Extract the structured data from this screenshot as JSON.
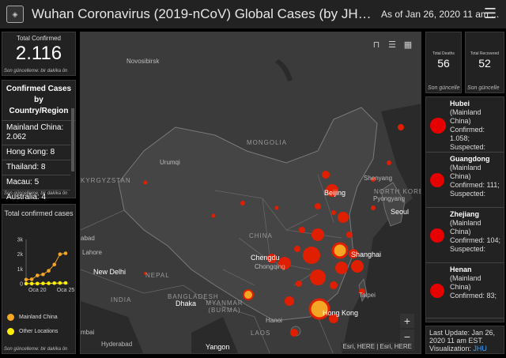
{
  "header": {
    "title": "Wuhan Coronavirus (2019-nCoV) Global Cases (by JHU ...",
    "as_of": "As of Jan 26, 2020 11 am ...",
    "menu_icon": "hamburger-menu-icon"
  },
  "total_confirmed": {
    "label": "Total Confirmed",
    "value": "2.116",
    "update_note": "Son güncelleme: bir dakika ön"
  },
  "country_list": {
    "heading": "Confirmed Cases by Country/Region",
    "rows": [
      "Mainland China: 2.062",
      "Hong Kong: 8",
      "Thailand: 8",
      "Macau: 5",
      "Australia: 4"
    ],
    "update_note": "Son güncelleme: bir dakika ön"
  },
  "chart_panel": {
    "heading": "Total confirmed cases",
    "legend": [
      "Mainland China",
      "Other Locations"
    ],
    "update_note": "Son güncelleme: bir dakika ön"
  },
  "chart_data": {
    "type": "line",
    "ylabel_ticks": [
      "0",
      "1k",
      "2k",
      "3k"
    ],
    "xlabel_ticks": [
      "Oca 20",
      "Oca 25"
    ],
    "ylim": [
      0,
      3000
    ],
    "x": [
      0,
      1,
      2,
      3,
      4,
      5,
      6,
      7
    ],
    "series": [
      {
        "name": "Mainland China",
        "values": [
          280,
          300,
          560,
          630,
          880,
          1300,
          2000,
          2062
        ],
        "color": "#f5a623"
      },
      {
        "name": "Other Locations",
        "values": [
          4,
          6,
          10,
          20,
          30,
          40,
          48,
          54
        ],
        "color": "#ffee00"
      }
    ]
  },
  "map": {
    "labels": {
      "novosibirsk": "Novosibirsk",
      "mongolia": "MONGOLIA",
      "urumqi": "Urumqi",
      "kyrgyzstan": "KYRGYZSTAN",
      "shenyang": "Shenyang",
      "beijing": "Beijing",
      "north_korea": "NORTH KOREA",
      "pyongyang": "Pyongyang",
      "seoul": "Seoul",
      "abad": "abad",
      "lahore": "Lahore",
      "china": "CHINA",
      "chengdu": "Chengdu",
      "chongqing": "Chongqing",
      "shanghai": "Shanghai",
      "new_delhi": "New Delhi",
      "nepal": "NEPAL",
      "india": "INDIA",
      "bangladesh": "BANGLADESH",
      "dhaka": "Dhaka",
      "myanmar": "MYANMAR (BURMA)",
      "taipei": "Taipei",
      "hong_kong": "Hong Kong",
      "hanoi": "Hanoi",
      "mbai": "mbai",
      "hyderabad": "Hyderabad",
      "yangon": "Yangon",
      "laos": "LAOS"
    },
    "attribution": "Esri, HERE | Esri, HERE",
    "zoom_in": "+",
    "zoom_out": "−"
  },
  "deaths": {
    "label": "Total Deaths",
    "value": "56",
    "update_note": "Son güncelle"
  },
  "recovered": {
    "label": "Total Recovered",
    "value": "52",
    "update_note": "Son güncelle"
  },
  "region_list": [
    {
      "name": "Hubei",
      "detail": "(Mainland China)",
      "confirmed": "Confirmed: 1.058;",
      "suspected": "Suspected:"
    },
    {
      "name": "Guangdong",
      "detail": "(Mainland China)",
      "confirmed": "Confirmed: 111;",
      "suspected": "Suspected:"
    },
    {
      "name": "Zhejiang",
      "detail": "(Mainland China)",
      "confirmed": "Confirmed: 104;",
      "suspected": "Suspected:"
    },
    {
      "name": "Henan",
      "detail": "(Mainland China)",
      "confirmed": "Confirmed: 83;",
      "suspected": ""
    }
  ],
  "last_update": {
    "line1": "Last Update: Jan 26, 2020 11 am EST.",
    "visualization_label": "Visualization:",
    "visualization_link": "JHU"
  }
}
